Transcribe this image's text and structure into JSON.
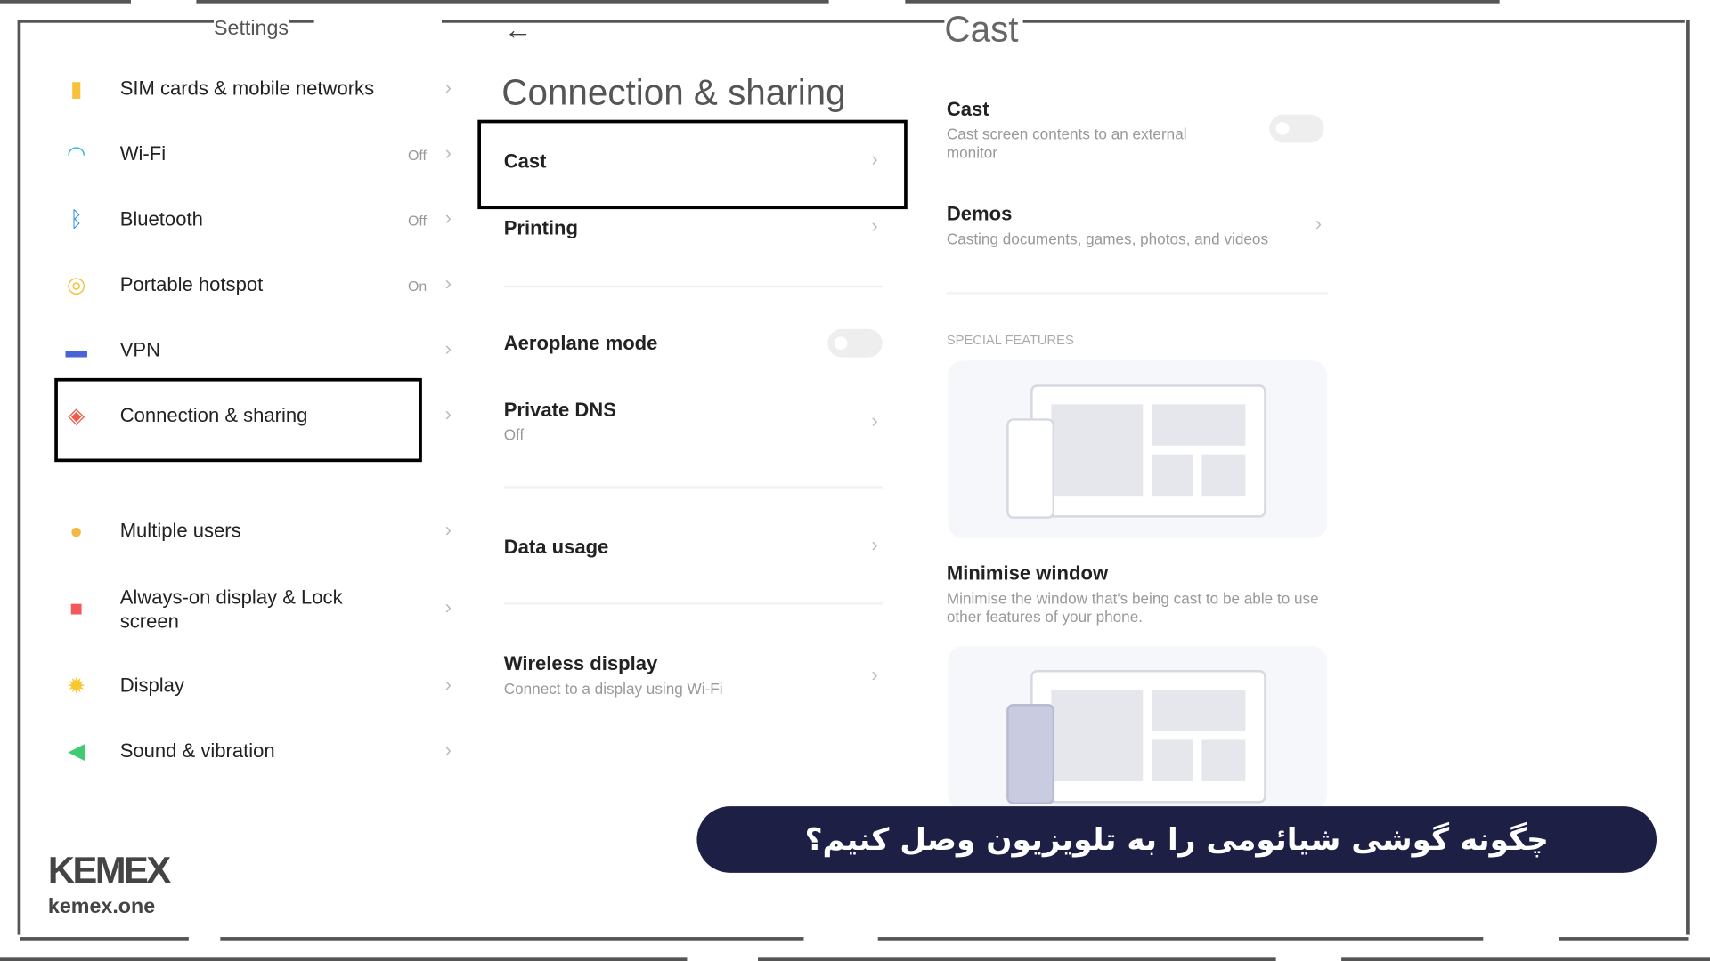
{
  "settings": {
    "title": "Settings",
    "items": [
      {
        "label": "SIM cards & mobile networks",
        "value": "",
        "icon": "sim-icon",
        "color": "#f7c23a"
      },
      {
        "label": "Wi-Fi",
        "value": "Off",
        "icon": "wifi-icon",
        "color": "#29b6e0"
      },
      {
        "label": "Bluetooth",
        "value": "Off",
        "icon": "bluetooth-icon",
        "color": "#2a8fe0"
      },
      {
        "label": "Portable hotspot",
        "value": "On",
        "icon": "hotspot-icon",
        "color": "#f2c23c"
      },
      {
        "label": "VPN",
        "value": "",
        "icon": "vpn-icon",
        "color": "#4a63d6"
      },
      {
        "label": "Connection & sharing",
        "value": "",
        "icon": "connection-icon",
        "color": "#ef5a4b"
      },
      {
        "label": "Multiple users",
        "value": "",
        "icon": "users-icon",
        "color": "#f5b843"
      },
      {
        "label": "Always-on display & Lock screen",
        "value": "",
        "icon": "lock-icon",
        "color": "#f25a5a"
      },
      {
        "label": "Display",
        "value": "",
        "icon": "sun-icon",
        "color": "#f9c82e"
      },
      {
        "label": "Sound & vibration",
        "value": "",
        "icon": "speaker-icon",
        "color": "#3ecb72"
      }
    ]
  },
  "connection": {
    "title": "Connection & sharing",
    "items": [
      {
        "label": "Cast",
        "sub": ""
      },
      {
        "label": "Printing",
        "sub": ""
      },
      {
        "label": "Aeroplane mode",
        "sub": "",
        "toggle": false
      },
      {
        "label": "Private DNS",
        "sub": "Off"
      },
      {
        "label": "Data usage",
        "sub": ""
      },
      {
        "label": "Wireless display",
        "sub": "Connect to a display using Wi-Fi"
      }
    ]
  },
  "cast": {
    "title": "Cast",
    "cast_item": {
      "label": "Cast",
      "sub": "Cast screen contents to an external monitor",
      "toggle": false
    },
    "demos": {
      "label": "Demos",
      "sub": "Casting documents, games, photos, and videos"
    },
    "section": "SPECIAL FEATURES",
    "minimise": {
      "label": "Minimise window",
      "sub": "Minimise the window that's being cast to be able to use other features of your phone."
    }
  },
  "banner": {
    "text": "چگونه گوشی شیائومی را به تلویزیون وصل کنیم؟",
    "color": "#1d1f45"
  },
  "brand": {
    "logo": "KEMEX",
    "url": "kemex.one"
  }
}
